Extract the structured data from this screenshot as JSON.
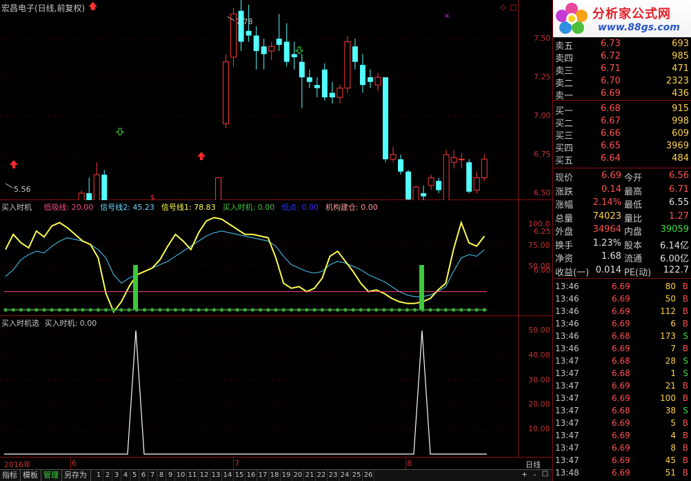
{
  "main_title": "宏昌电子(日线,前复权)",
  "price_axis": [
    "7.50",
    "7.25",
    "7.00",
    "6.75",
    "6.50",
    "6.25",
    "6.00"
  ],
  "high_label": "7.78",
  "low_label": "5.56",
  "ind1": {
    "name": "买入时机",
    "items": [
      {
        "label": "低吸线: 20.00",
        "color": "#ff4a8a"
      },
      {
        "label": "信号线2: 45.23",
        "color": "#6ad8ff"
      },
      {
        "label": "信号线1: 78.83",
        "color": "#ffff50"
      },
      {
        "label": "买入时机: 0.00",
        "color": "#3cc83c"
      },
      {
        "label": "低点: 0.00",
        "color": "#3232ff"
      },
      {
        "label": "机构建仓: 0.00",
        "color": "#ff9a9a"
      }
    ],
    "axis": [
      "100.0",
      "75.00",
      "50.00"
    ]
  },
  "ind2": {
    "title": "买入时机选",
    "value": "买入时机: 0.00",
    "axis": [
      "50.00",
      "40.00",
      "30.00",
      "20.00",
      "10.00"
    ]
  },
  "date_axis": {
    "year": "2016年",
    "m6": "6",
    "m7": "7",
    "m8": "8",
    "period": "日线"
  },
  "chart_data": {
    "type": "candlestick",
    "candles": [
      [
        5.73,
        5.88,
        5.58,
        5.73
      ],
      [
        5.8,
        5.82,
        5.7,
        5.74
      ],
      [
        5.7,
        5.77,
        5.62,
        5.76
      ],
      [
        5.72,
        5.75,
        5.63,
        5.65
      ],
      [
        5.66,
        5.72,
        5.55,
        5.62
      ],
      [
        5.68,
        6.12,
        5.66,
        6.1
      ],
      [
        6.05,
        6.25,
        6.0,
        6.25
      ],
      [
        6.1,
        6.12,
        5.98,
        6.0
      ],
      [
        6.08,
        6.3,
        6.06,
        6.27
      ],
      [
        6.25,
        6.38,
        6.22,
        6.38
      ],
      [
        6.38,
        6.52,
        6.34,
        6.5
      ],
      [
        6.5,
        6.6,
        6.4,
        6.45
      ],
      [
        6.43,
        6.7,
        6.36,
        6.62
      ],
      [
        6.62,
        6.65,
        6.33,
        6.33
      ],
      [
        6.34,
        6.38,
        6.3,
        6.34
      ],
      [
        6.35,
        6.4,
        6.28,
        6.35
      ],
      [
        6.33,
        6.36,
        6.24,
        6.25
      ],
      [
        6.2,
        6.22,
        6.0,
        6.0
      ],
      [
        5.98,
        6.08,
        5.96,
        6.06
      ],
      [
        6.0,
        6.12,
        5.98,
        6.08
      ],
      [
        6.1,
        6.25,
        6.08,
        6.2
      ],
      [
        6.2,
        6.28,
        6.15,
        6.18
      ],
      [
        6.18,
        6.26,
        6.12,
        6.22
      ],
      [
        6.15,
        6.2,
        6.05,
        6.12
      ],
      [
        6.12,
        6.16,
        6.05,
        6.1
      ],
      [
        6.15,
        6.28,
        6.1,
        6.2
      ],
      [
        6.2,
        6.34,
        6.18,
        6.28
      ],
      [
        6.3,
        6.33,
        6.15,
        6.18
      ],
      [
        6.05,
        6.6,
        6.05,
        6.6
      ],
      [
        6.95,
        7.4,
        6.92,
        7.35
      ],
      [
        7.38,
        7.7,
        7.32,
        7.66
      ],
      [
        7.68,
        7.78,
        7.42,
        7.48
      ],
      [
        7.55,
        7.72,
        7.48,
        7.52
      ],
      [
        7.52,
        7.58,
        7.3,
        7.42
      ],
      [
        7.45,
        7.5,
        7.3,
        7.4
      ],
      [
        7.42,
        7.48,
        7.36,
        7.45
      ],
      [
        7.5,
        7.66,
        7.42,
        7.46
      ],
      [
        7.48,
        7.6,
        7.32,
        7.35
      ],
      [
        7.4,
        7.48,
        7.3,
        7.38
      ],
      [
        7.35,
        7.4,
        7.05,
        7.25
      ],
      [
        7.25,
        7.3,
        7.18,
        7.22
      ],
      [
        7.2,
        7.25,
        7.12,
        7.18
      ],
      [
        7.3,
        7.34,
        7.1,
        7.12
      ],
      [
        7.15,
        7.22,
        7.08,
        7.12
      ],
      [
        7.12,
        7.2,
        7.08,
        7.18
      ],
      [
        7.18,
        7.52,
        7.15,
        7.48
      ],
      [
        7.45,
        7.5,
        7.3,
        7.35
      ],
      [
        7.33,
        7.4,
        7.15,
        7.2
      ],
      [
        7.25,
        7.3,
        7.18,
        7.22
      ],
      [
        7.2,
        7.28,
        7.16,
        7.25
      ],
      [
        7.25,
        7.25,
        6.7,
        6.72
      ],
      [
        6.72,
        6.8,
        6.7,
        6.75
      ],
      [
        6.72,
        6.75,
        6.62,
        6.64
      ],
      [
        6.64,
        6.65,
        6.34,
        6.46
      ],
      [
        6.45,
        6.55,
        6.4,
        6.54
      ],
      [
        6.5,
        6.55,
        6.42,
        6.48
      ],
      [
        6.55,
        6.62,
        6.52,
        6.6
      ],
      [
        6.58,
        6.6,
        6.5,
        6.52
      ],
      [
        6.45,
        6.78,
        6.43,
        6.75
      ],
      [
        6.7,
        6.78,
        6.66,
        6.73
      ],
      [
        6.72,
        6.76,
        6.66,
        6.72
      ],
      [
        6.7,
        6.72,
        6.5,
        6.51
      ],
      [
        6.52,
        6.64,
        6.5,
        6.6
      ],
      [
        6.6,
        6.75,
        6.58,
        6.72
      ]
    ]
  },
  "quote": {
    "ask": [
      {
        "label": "卖五",
        "price": "6.73",
        "vol": "693"
      },
      {
        "label": "卖四",
        "price": "6.72",
        "vol": "985"
      },
      {
        "label": "卖三",
        "price": "6.71",
        "vol": "471"
      },
      {
        "label": "卖二",
        "price": "6.70",
        "vol": "2323"
      },
      {
        "label": "卖一",
        "price": "6.69",
        "vol": "436"
      }
    ],
    "bid": [
      {
        "label": "买一",
        "price": "6.68",
        "vol": "915"
      },
      {
        "label": "买二",
        "price": "6.67",
        "vol": "998"
      },
      {
        "label": "买三",
        "price": "6.66",
        "vol": "609"
      },
      {
        "label": "买四",
        "price": "6.65",
        "vol": "3969"
      },
      {
        "label": "买五",
        "price": "6.64",
        "vol": "484"
      }
    ],
    "stats": [
      [
        {
          "t": "现价",
          "c": "#c8c8c8"
        },
        {
          "t": "6.69",
          "c": "#ff5050"
        },
        {
          "t": "今开",
          "c": "#c8c8c8"
        },
        {
          "t": "6.56",
          "c": "#ff5050"
        }
      ],
      [
        {
          "t": "涨跌",
          "c": "#c8c8c8"
        },
        {
          "t": "0.14",
          "c": "#ff5050"
        },
        {
          "t": "最高",
          "c": "#c8c8c8"
        },
        {
          "t": "6.71",
          "c": "#ff5050"
        }
      ],
      [
        {
          "t": "涨幅",
          "c": "#c8c8c8"
        },
        {
          "t": "2.14%",
          "c": "#ff5050"
        },
        {
          "t": "最低",
          "c": "#c8c8c8"
        },
        {
          "t": "6.55",
          "c": "#e0e0e0"
        }
      ],
      [
        {
          "t": "总量",
          "c": "#c8c8c8"
        },
        {
          "t": "74023",
          "c": "#ffd24a"
        },
        {
          "t": "量比",
          "c": "#c8c8c8"
        },
        {
          "t": "1.27",
          "c": "#ff5050"
        }
      ],
      [
        {
          "t": "外盘",
          "c": "#c8c8c8"
        },
        {
          "t": "34964",
          "c": "#ff5050"
        },
        {
          "t": "内盘",
          "c": "#c8c8c8"
        },
        {
          "t": "39059",
          "c": "#3cdc3c"
        }
      ],
      [
        {
          "t": "换手",
          "c": "#c8c8c8"
        },
        {
          "t": "1.23%",
          "c": "#e0e0e0"
        },
        {
          "t": "股本",
          "c": "#c8c8c8"
        },
        {
          "t": "6.14亿",
          "c": "#e0e0e0"
        }
      ],
      [
        {
          "t": "净资",
          "c": "#c8c8c8"
        },
        {
          "t": "1.68",
          "c": "#e0e0e0"
        },
        {
          "t": "流通",
          "c": "#c8c8c8"
        },
        {
          "t": "6.00亿",
          "c": "#e0e0e0"
        }
      ],
      [
        {
          "t": "收益(一)",
          "c": "#c8c8c8"
        },
        {
          "t": "0.014",
          "c": "#e0e0e0"
        },
        {
          "t": "PE(动)",
          "c": "#c8c8c8"
        },
        {
          "t": "122.7",
          "c": "#e0e0e0"
        }
      ]
    ],
    "ticks": [
      [
        "13:46",
        "6.69",
        "80",
        "B"
      ],
      [
        "13:46",
        "6.69",
        "50",
        "B"
      ],
      [
        "13:46",
        "6.69",
        "112",
        "B"
      ],
      [
        "13:46",
        "6.69",
        "6",
        "B"
      ],
      [
        "13:46",
        "6.68",
        "173",
        "S"
      ],
      [
        "13:46",
        "6.69",
        "7",
        "B"
      ],
      [
        "13:47",
        "6.68",
        "28",
        "S"
      ],
      [
        "13:47",
        "6.68",
        "1",
        "S"
      ],
      [
        "13:47",
        "6.69",
        "21",
        "B"
      ],
      [
        "13:47",
        "6.69",
        "100",
        "B"
      ],
      [
        "13:47",
        "6.68",
        "38",
        "S"
      ],
      [
        "13:47",
        "6.69",
        "5",
        "B"
      ],
      [
        "13:47",
        "6.69",
        "4",
        "B"
      ],
      [
        "13:47",
        "6.69",
        "8",
        "B"
      ],
      [
        "13:47",
        "6.69",
        "45",
        "B"
      ],
      [
        "13:48",
        "6.69",
        "51",
        "B"
      ]
    ]
  },
  "logo": {
    "brand": "分析家公式网",
    "url": "www.88gs.com"
  },
  "bottom_tabs": [
    "指标",
    "模板",
    "管理",
    "另存为"
  ],
  "date_tabs": [
    "1",
    "2",
    "3",
    "4",
    "5",
    "6",
    "7",
    "8",
    "9",
    "10",
    "11",
    "12",
    "13",
    "14",
    "15",
    "16",
    "17",
    "18",
    "19",
    "20",
    "21",
    "22",
    "23",
    "24",
    "25",
    "26"
  ],
  "nav": {
    "plus": "+",
    "minus": "-",
    "menu": "□"
  }
}
